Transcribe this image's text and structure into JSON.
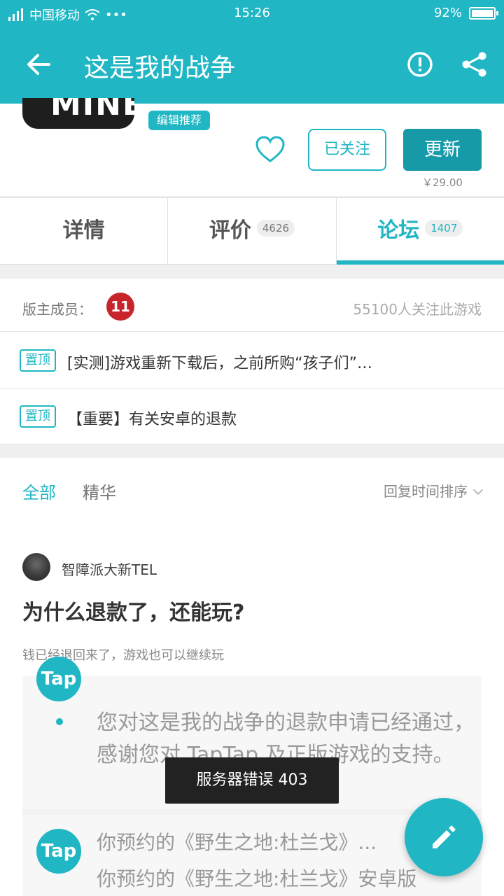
{
  "status_bar": {
    "carrier": "中国移动",
    "time": "15:26",
    "battery": "92%"
  },
  "app_bar": {
    "title": "这是我的战争"
  },
  "game": {
    "cover_text": "MINE",
    "tag": "编辑推荐",
    "follow_label": "已关注",
    "update_label": "更新",
    "price": "￥29.00"
  },
  "tabs": [
    {
      "label": "详情",
      "count": ""
    },
    {
      "label": "评价",
      "count": "4626"
    },
    {
      "label": "论坛",
      "count": "1407"
    }
  ],
  "forum": {
    "moderators_label": "版主成员：",
    "moderator_avatar_text": "11",
    "followers": "55100人关注此游戏",
    "pinned": [
      {
        "tag": "置顶",
        "title": "[实测]游戏重新下载后，之前所购“孩子们”…"
      },
      {
        "tag": "置顶",
        "title": "【重要】有关安卓的退款"
      }
    ]
  },
  "filters": {
    "all": "全部",
    "featured": "精华",
    "sort": "回复时间排序"
  },
  "post": {
    "author": "智障派大新TEL",
    "title": "为什么退款了，还能玩?",
    "body": "钱已经退回来了，游戏也可以继续玩",
    "screenshot": {
      "logo_text": "Tap",
      "message_1": "您对这是我的战争的退款申请已经通过，感谢您对 TapTap 及正版游戏的支持。",
      "heading_2": "你预约的《野生之地:杜兰戈》...",
      "message_2": "你预约的《野生之地:杜兰戈》安卓版"
    }
  },
  "toast": "服务器错误 403",
  "colors": {
    "accent": "#20b6c4",
    "update_button": "#179aa8"
  }
}
